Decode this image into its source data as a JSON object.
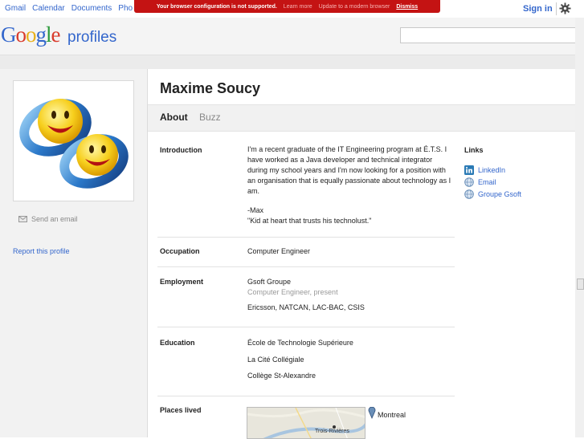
{
  "topnav": {
    "items": [
      "Gmail",
      "Calendar",
      "Documents",
      "Pho"
    ],
    "sign_in": "Sign in"
  },
  "warning": {
    "message": "Your browser configuration is not supported.",
    "learn_more": "Learn more",
    "update": "Update to a modern browser",
    "dismiss": "Dismiss"
  },
  "header": {
    "logo_letters": [
      "G",
      "o",
      "o",
      "g",
      "l",
      "e"
    ],
    "product": "profiles",
    "search_placeholder": ""
  },
  "sidebar": {
    "send_email": "Send an email",
    "report": "Report this profile"
  },
  "profile": {
    "name": "Maxime Soucy",
    "tabs": [
      "About",
      "Buzz"
    ],
    "introduction_label": "Introduction",
    "introduction_text": "I'm a recent graduate of the IT Engineering program at É.T.S. I have worked as a Java developer and technical integrator during my school years and I'm now looking for a position with an organisation that is equally passionate about technology as I am.",
    "introduction_sig1": "-Max",
    "introduction_sig2": "\"Kid at heart that trusts his technolust.\"",
    "occupation_label": "Occupation",
    "occupation": "Computer Engineer",
    "employment_label": "Employment",
    "employer": "Gsoft Groupe",
    "employer_role": "Computer Engineer, present",
    "employment_other": "Ericsson, NATCAN, LAC-BAC, CSIS",
    "education_label": "Education",
    "education": [
      "École de Technologie Supérieure",
      "La Cité Collégiale",
      "Collège St-Alexandre"
    ],
    "places_label": "Places lived",
    "place": "Montreal",
    "map_city": "Trois-Rivières"
  },
  "links": {
    "heading": "Links",
    "items": [
      "LinkedIn",
      "Email",
      "Groupe Gsoft"
    ]
  },
  "colors": {
    "link_blue": "#3366cc",
    "warning_red": "#c41313",
    "linkedin_blue": "#2a7ab5"
  }
}
